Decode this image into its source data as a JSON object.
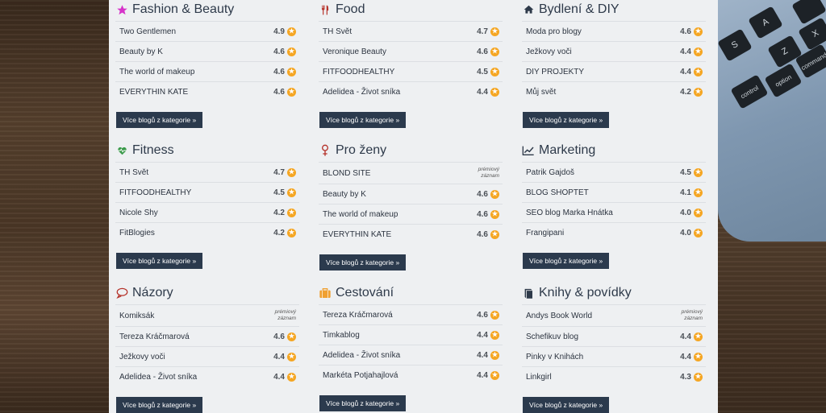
{
  "sections": [
    {
      "title": "Fashion & Beauty",
      "icon": "star-icon",
      "icon_color": "#d633c9",
      "items": [
        {
          "name": "Two Gentlemen",
          "rating": "4.9"
        },
        {
          "name": "Beauty by K",
          "rating": "4.6"
        },
        {
          "name": "The world of makeup",
          "rating": "4.6"
        },
        {
          "name": "EVERYTHIN KATE",
          "rating": "4.6"
        }
      ],
      "button": "Více blogů z kategorie »"
    },
    {
      "title": "Food",
      "icon": "cutlery-icon",
      "icon_color": "#b5322a",
      "items": [
        {
          "name": "TH Svět",
          "rating": "4.7"
        },
        {
          "name": "Veronique Beauty",
          "rating": "4.6"
        },
        {
          "name": "FITFOODHEALTHY",
          "rating": "4.5"
        },
        {
          "name": "Adelidea - Život sníka",
          "rating": "4.4"
        }
      ],
      "button": "Více blogů z kategorie »"
    },
    {
      "title": "Bydlení & DIY",
      "icon": "home-icon",
      "icon_color": "#2e3a4a",
      "items": [
        {
          "name": "Moda pro blogy",
          "rating": "4.6"
        },
        {
          "name": "Ježkovy voči",
          "rating": "4.4"
        },
        {
          "name": "DIY PROJEKTY",
          "rating": "4.4"
        },
        {
          "name": "Můj svět",
          "rating": "4.2"
        }
      ],
      "button": "Více blogů z kategorie »"
    },
    {
      "title": "Fitness",
      "icon": "heartbeat-icon",
      "icon_color": "#3a9a4a",
      "items": [
        {
          "name": "TH Svět",
          "rating": "4.7"
        },
        {
          "name": "FITFOODHEALTHY",
          "rating": "4.5"
        },
        {
          "name": "Nicole Shy",
          "rating": "4.2"
        },
        {
          "name": "FitBlogies",
          "rating": "4.2"
        }
      ],
      "button": "Více blogů z kategorie »"
    },
    {
      "title": "Pro ženy",
      "icon": "female-icon",
      "icon_color": "#b5322a",
      "items": [
        {
          "name": "BLOND SITE",
          "premium": "prémiový záznam"
        },
        {
          "name": "Beauty by K",
          "rating": "4.6"
        },
        {
          "name": "The world of makeup",
          "rating": "4.6"
        },
        {
          "name": "EVERYTHIN KATE",
          "rating": "4.6"
        }
      ],
      "button": "Více blogů z kategorie »"
    },
    {
      "title": "Marketing",
      "icon": "line-chart-icon",
      "icon_color": "#2e3a4a",
      "items": [
        {
          "name": "Patrik Gajdoš",
          "rating": "4.5"
        },
        {
          "name": "BLOG SHOPTET",
          "rating": "4.1"
        },
        {
          "name": "SEO blog Marka Hnátka",
          "rating": "4.0"
        },
        {
          "name": "Frangipani",
          "rating": "4.0"
        }
      ],
      "button": "Více blogů z kategorie »"
    },
    {
      "title": "Názory",
      "icon": "comment-icon",
      "icon_color": "#b5322a",
      "items": [
        {
          "name": "Komiksák",
          "premium": "prémiový záznam"
        },
        {
          "name": "Tereza Kráčmarová",
          "rating": "4.6"
        },
        {
          "name": "Ježkovy voči",
          "rating": "4.4"
        },
        {
          "name": "Adelidea - Život sníka",
          "rating": "4.4"
        }
      ],
      "button": "Více blogů z kategorie »"
    },
    {
      "title": "Cestování",
      "icon": "suitcase-icon",
      "icon_color": "#f0a030",
      "items": [
        {
          "name": "Tereza Kráčmarová",
          "rating": "4.6"
        },
        {
          "name": "Timkablog",
          "rating": "4.4"
        },
        {
          "name": "Adelidea - Život sníka",
          "rating": "4.4"
        },
        {
          "name": "Markéta Potjahajlová",
          "rating": "4.4"
        }
      ],
      "button": "Více blogů z kategorie »"
    },
    {
      "title": "Knihy & povídky",
      "icon": "book-icon",
      "icon_color": "#2e3a4a",
      "items": [
        {
          "name": "Andys Book World",
          "premium": "prémiový záznam"
        },
        {
          "name": "Schefikuv blog",
          "rating": "4.4"
        },
        {
          "name": "Pinky v Knihách",
          "rating": "4.4"
        },
        {
          "name": "Linkgirl",
          "rating": "4.3"
        }
      ],
      "button": "Více blogů z kategorie »"
    }
  ],
  "keyboard_keys": [
    "A",
    "Z",
    "X",
    "S",
    "option",
    "control",
    "command"
  ]
}
